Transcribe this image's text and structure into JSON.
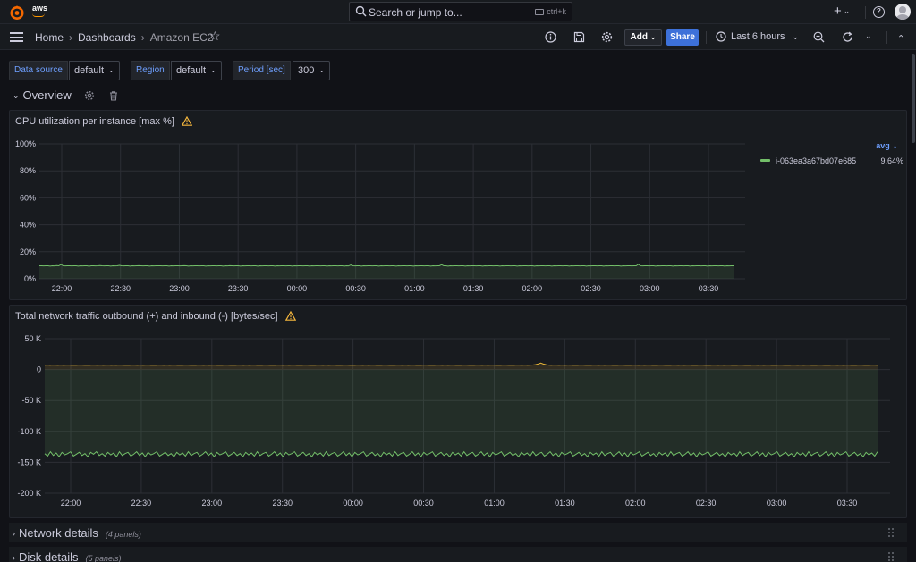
{
  "topbar": {
    "org_label": "aws",
    "search_placeholder": "Search or jump to...",
    "search_shortcut": "ctrl+k",
    "plus_label": "+",
    "help_label": "?"
  },
  "breadcrumb": {
    "home": "Home",
    "dashboards": "Dashboards",
    "current": "Amazon EC2",
    "separator": "›"
  },
  "toolbar": {
    "add_label": "Add",
    "share_label": "Share",
    "time_range": "Last 6 hours",
    "chevron": "⌄"
  },
  "variables": [
    {
      "label": "Data source",
      "value": "default"
    },
    {
      "label": "Region",
      "value": "default"
    },
    {
      "label": "Period [sec]",
      "value": "300"
    }
  ],
  "rows": {
    "overview": {
      "title": "Overview"
    },
    "network_details": {
      "title": "Network details",
      "count": "(4 panels)"
    },
    "disk_details": {
      "title": "Disk details",
      "count": "(5 panels)"
    }
  },
  "colors": {
    "green_series": "#73bf69",
    "yellow_series": "#eab839",
    "accent_blue": "#3d71d9",
    "warning": "#f5b73d"
  },
  "chart_data": [
    {
      "type": "line",
      "title": "CPU utilization per instance [max %]",
      "x_ticks": [
        "22:00",
        "22:30",
        "23:00",
        "23:30",
        "00:00",
        "00:30",
        "01:00",
        "01:30",
        "02:00",
        "02:30",
        "03:00",
        "03:30"
      ],
      "y_ticks": [
        "0%",
        "20%",
        "40%",
        "60%",
        "80%",
        "100%"
      ],
      "ylim": [
        0,
        100
      ],
      "legend_calc": "avg",
      "legend_placement": "right",
      "series": [
        {
          "name": "i-063ea3a67bd07e685",
          "legend_value": "9.64%",
          "color": "#73bf69",
          "values": [
            9.6,
            9.6,
            9.5,
            9.6,
            9.6,
            9.4,
            9.6,
            9.5,
            9.8,
            9.6,
            10.6,
            9.6,
            9.5,
            9.6,
            9.6,
            9.5,
            9.6,
            9.6,
            9.4,
            9.6,
            9.5,
            9.6,
            9.6,
            9.3,
            9.6,
            9.6,
            9.5,
            9.6,
            9.8,
            9.6,
            9.5,
            9.6,
            9.6,
            9.4,
            9.6,
            9.5,
            9.6,
            9.9,
            9.6,
            9.5,
            9.6,
            9.6,
            9.4,
            9.6,
            9.5,
            9.6,
            9.7,
            9.6,
            9.5,
            9.6,
            9.6,
            9.4,
            9.6,
            9.5,
            9.6,
            9.6,
            9.6,
            9.5,
            9.6,
            9.6,
            9.4,
            9.6,
            9.5,
            9.6,
            9.6,
            9.5,
            9.6,
            9.7,
            9.6,
            9.4,
            9.6,
            9.5,
            9.6,
            9.6,
            9.5,
            9.6,
            9.6,
            9.4,
            9.6,
            9.5,
            9.6,
            9.6,
            9.5,
            9.6,
            9.6,
            9.4,
            9.6,
            9.5,
            9.7,
            9.6,
            9.5,
            9.6,
            9.6,
            9.4,
            9.6,
            9.5,
            9.6,
            9.6,
            9.5,
            9.6,
            9.6,
            9.4,
            9.6,
            9.5,
            9.6,
            9.6,
            9.5,
            9.6,
            9.6,
            9.4,
            9.6,
            9.5,
            9.6,
            9.6,
            9.5,
            9.6,
            9.6,
            9.4,
            9.6,
            9.5,
            9.6,
            9.6,
            9.5,
            9.6,
            9.6,
            9.4,
            9.6,
            9.5,
            9.6,
            9.6,
            9.5,
            9.6,
            9.6,
            9.4,
            9.6,
            9.5,
            9.6,
            9.6,
            9.5,
            9.6,
            9.6,
            9.4,
            9.6,
            9.5,
            10.2,
            9.6,
            9.5,
            9.6,
            9.6,
            9.4,
            9.6,
            9.5,
            9.6,
            9.6,
            9.5,
            9.6,
            9.6,
            9.4,
            9.6,
            9.5,
            9.6,
            9.6,
            9.5,
            9.6,
            9.6,
            9.4,
            9.6,
            9.5,
            9.6,
            9.6,
            9.5,
            9.6,
            9.6,
            9.4,
            9.6,
            9.5,
            9.6,
            9.6,
            9.5,
            9.6,
            9.6,
            9.4,
            9.6,
            9.5,
            9.6,
            9.6,
            10.4,
            9.6,
            9.6,
            9.4,
            9.6,
            9.5,
            9.6,
            9.6,
            9.5,
            9.6,
            9.6,
            9.4,
            9.6,
            9.5,
            9.6,
            9.6,
            9.5,
            9.6,
            9.6,
            9.4,
            9.6,
            9.5,
            9.6,
            9.6,
            9.5,
            9.6,
            9.6,
            9.4,
            9.6,
            9.5,
            9.6,
            9.6,
            9.5,
            9.6,
            9.6,
            9.4,
            9.6,
            9.5,
            9.6,
            9.6,
            9.5,
            9.6,
            9.6,
            9.4,
            9.6,
            9.5,
            9.6,
            9.6,
            9.5,
            9.6,
            9.6,
            9.4,
            9.6,
            9.5,
            9.6,
            9.6,
            9.5,
            9.6,
            9.6,
            9.4,
            9.6,
            9.5,
            9.6,
            9.6,
            9.5,
            9.6,
            9.6,
            9.4,
            9.6,
            9.5,
            9.6,
            9.6,
            9.5,
            9.6,
            9.6,
            9.4,
            9.6,
            9.5,
            9.6,
            9.6,
            9.5,
            9.6,
            9.6,
            9.4,
            9.6,
            9.5,
            9.6,
            9.6,
            9.5,
            9.6,
            9.6,
            10.8,
            9.6,
            9.5,
            9.6,
            9.6,
            9.5,
            9.6,
            9.6,
            9.4,
            9.6,
            9.5,
            9.6,
            9.6,
            9.5,
            9.6,
            9.6,
            9.4,
            9.6,
            9.5,
            9.6,
            9.6,
            9.5,
            9.6,
            9.6,
            9.4,
            9.6,
            9.5,
            9.6,
            9.6,
            9.5,
            9.6,
            9.6,
            9.4,
            9.6,
            9.5,
            9.6,
            9.6,
            9.5,
            9.6,
            9.6,
            9.4,
            9.6,
            9.5,
            9.6,
            9.6
          ]
        }
      ]
    },
    {
      "type": "line",
      "title": "Total network traffic outbound (+) and inbound (-) [bytes/sec]",
      "x_ticks": [
        "22:00",
        "22:30",
        "23:00",
        "23:30",
        "00:00",
        "00:30",
        "01:00",
        "01:30",
        "02:00",
        "02:30",
        "03:00",
        "03:30"
      ],
      "y_ticks": [
        "50 K",
        "0",
        "-50 K",
        "-100 K",
        "-150 K",
        "-200 K"
      ],
      "ylim": [
        -200000,
        50000
      ],
      "series": [
        {
          "color": "#eab839",
          "values": [
            7000,
            7400,
            7100,
            7300,
            7200,
            7000,
            7300,
            7100,
            7200,
            7400,
            7000,
            7200,
            7100,
            7300,
            7200,
            7000,
            7200,
            7100,
            7300,
            7200,
            7000,
            7300,
            7100,
            7200,
            7400,
            7000,
            7200,
            7100,
            7300,
            7200,
            7000,
            7200,
            7100,
            7300,
            7200,
            7000,
            7300,
            7100,
            7200,
            7400,
            7000,
            7200,
            7100,
            7300,
            7200,
            7000,
            7300,
            7100,
            7200,
            7400,
            7000,
            7200,
            7100,
            7300,
            7200,
            7000,
            7200,
            7100,
            7300,
            7200,
            7000,
            7300,
            7100,
            7200,
            7400,
            7000,
            7200,
            7100,
            7300,
            7200,
            7000,
            7200,
            7100,
            7300,
            7200,
            7000,
            7300,
            7100,
            7200,
            7400,
            7000,
            7200,
            7100,
            7300,
            7200,
            7000,
            7200,
            7100,
            7300,
            7200,
            7000,
            7300,
            7100,
            7200,
            7400,
            7000,
            7200,
            7100,
            7300,
            7200,
            7000,
            7200,
            7100,
            7300,
            7200,
            7000,
            7300,
            7100,
            7200,
            7400,
            7000,
            7200,
            7100,
            7300,
            7200,
            7000,
            7200,
            7100,
            7300,
            7200,
            7000,
            7300,
            7100,
            7200,
            7400,
            7000,
            7200,
            7100,
            7300,
            7200,
            7000,
            7200,
            7100,
            7300,
            7200,
            7000,
            7300,
            7100,
            7200,
            7400,
            7000,
            7200,
            7100,
            7300,
            7200,
            7000,
            7200,
            7100,
            7300,
            7200,
            7000,
            7300,
            7100,
            7200,
            7400,
            7000,
            7200,
            7100,
            7300,
            7200,
            7000,
            7200,
            7100,
            7300,
            7200,
            7000,
            7300,
            7100,
            7200,
            7400,
            7000,
            7200,
            7100,
            7300,
            7200,
            7000,
            7200,
            7100,
            7300,
            7200,
            7000,
            7300,
            7100,
            7200,
            7400,
            8000,
            9000,
            10500,
            9000,
            8000,
            7200,
            7100,
            7300,
            7200,
            7000,
            7300,
            7100,
            7200,
            7400,
            7000,
            7200,
            7100,
            7300,
            7200,
            7000,
            7200,
            7100,
            7300,
            7200,
            7000,
            7300,
            7100,
            7200,
            7400,
            7000,
            7200,
            7100,
            7300,
            7200,
            7000,
            7200,
            7100,
            7300,
            7200,
            7000,
            7300,
            7100,
            7200,
            7400,
            7000,
            7200,
            7100,
            7300,
            7200,
            7000,
            7200,
            7100,
            7300,
            7200,
            7000,
            7300,
            7100,
            7200,
            7400,
            7000,
            7200,
            7100,
            7300,
            7200,
            7000,
            7200,
            7100,
            7300,
            7200,
            7000,
            7300,
            7100,
            7200,
            7400,
            7000,
            7200,
            7100,
            7300,
            7200,
            7000,
            7200,
            7100,
            7300,
            7200,
            7000,
            7300,
            7100,
            7200,
            7400,
            7000,
            7200,
            7100,
            7300,
            7200,
            7000,
            7200,
            7100,
            7300,
            7200,
            7000,
            7300,
            7100,
            7200,
            7400,
            7000,
            7200,
            7100,
            7300,
            7200,
            7000,
            7200,
            7100,
            7300,
            7200,
            7000,
            7300,
            7100,
            7200,
            7400,
            7000,
            7200,
            7100,
            7300,
            7200,
            7000,
            7200,
            7100,
            7300,
            7200,
            7000
          ]
        },
        {
          "color": "#73bf69",
          "values": [
            -136000,
            -140000,
            -133000,
            -139000,
            -135000,
            -141000,
            -134000,
            -138000,
            -136000,
            -133000,
            -140000,
            -137000,
            -134000,
            -139000,
            -136000,
            -141000,
            -134000,
            -137000,
            -133000,
            -139000,
            -136000,
            -140000,
            -134000,
            -138000,
            -135000,
            -141000,
            -133000,
            -139000,
            -136000,
            -134000,
            -140000,
            -137000,
            -133000,
            -139000,
            -135000,
            -141000,
            -134000,
            -138000,
            -136000,
            -133000,
            -140000,
            -137000,
            -134000,
            -139000,
            -136000,
            -141000,
            -134000,
            -138000,
            -135000,
            -140000,
            -133000,
            -139000,
            -136000,
            -134000,
            -140000,
            -137000,
            -133000,
            -139000,
            -135000,
            -141000,
            -134000,
            -138000,
            -136000,
            -133000,
            -140000,
            -137000,
            -134000,
            -139000,
            -136000,
            -141000,
            -134000,
            -138000,
            -135000,
            -140000,
            -133000,
            -139000,
            -136000,
            -134000,
            -140000,
            -137000,
            -133000,
            -139000,
            -135000,
            -141000,
            -134000,
            -138000,
            -136000,
            -133000,
            -140000,
            -137000,
            -134000,
            -139000,
            -136000,
            -141000,
            -134000,
            -138000,
            -135000,
            -140000,
            -133000,
            -139000,
            -136000,
            -134000,
            -140000,
            -137000,
            -133000,
            -139000,
            -135000,
            -141000,
            -134000,
            -138000,
            -136000,
            -133000,
            -140000,
            -137000,
            -134000,
            -139000,
            -136000,
            -141000,
            -134000,
            -138000,
            -135000,
            -140000,
            -133000,
            -139000,
            -136000,
            -134000,
            -140000,
            -137000,
            -133000,
            -139000,
            -135000,
            -141000,
            -134000,
            -138000,
            -136000,
            -133000,
            -140000,
            -137000,
            -134000,
            -139000,
            -136000,
            -141000,
            -134000,
            -138000,
            -135000,
            -140000,
            -133000,
            -139000,
            -136000,
            -134000,
            -140000,
            -137000,
            -133000,
            -139000,
            -135000,
            -141000,
            -134000,
            -138000,
            -136000,
            -133000,
            -140000,
            -137000,
            -134000,
            -139000,
            -136000,
            -141000,
            -134000,
            -138000,
            -135000,
            -140000,
            -133000,
            -139000,
            -136000,
            -134000,
            -140000,
            -137000,
            -133000,
            -139000,
            -135000,
            -141000,
            -134000,
            -138000,
            -136000,
            -133000,
            -140000,
            -137000,
            -134000,
            -139000,
            -136000,
            -141000,
            -134000,
            -138000,
            -135000,
            -140000,
            -133000,
            -139000,
            -136000,
            -134000,
            -140000,
            -137000,
            -133000,
            -139000,
            -135000,
            -141000,
            -134000,
            -138000,
            -136000,
            -133000,
            -140000,
            -137000,
            -134000,
            -139000,
            -136000,
            -141000,
            -134000,
            -138000,
            -135000,
            -140000,
            -133000,
            -139000,
            -136000,
            -134000,
            -140000,
            -137000,
            -133000,
            -139000,
            -135000,
            -141000,
            -134000,
            -138000,
            -136000,
            -133000,
            -140000,
            -137000,
            -134000,
            -139000,
            -136000,
            -141000,
            -134000,
            -138000,
            -135000,
            -140000,
            -133000,
            -139000,
            -136000,
            -134000,
            -140000,
            -137000,
            -133000,
            -139000,
            -135000,
            -141000,
            -134000,
            -138000,
            -136000,
            -133000,
            -140000,
            -137000,
            -134000,
            -139000,
            -136000,
            -141000,
            -134000,
            -138000,
            -135000,
            -140000,
            -133000,
            -139000,
            -136000,
            -134000,
            -140000,
            -137000,
            -133000,
            -139000,
            -135000,
            -141000,
            -134000,
            -138000,
            -136000,
            -133000,
            -140000,
            -137000,
            -134000,
            -139000,
            -136000,
            -141000,
            -134000,
            -138000,
            -135000,
            -140000,
            -133000
          ]
        }
      ]
    }
  ]
}
